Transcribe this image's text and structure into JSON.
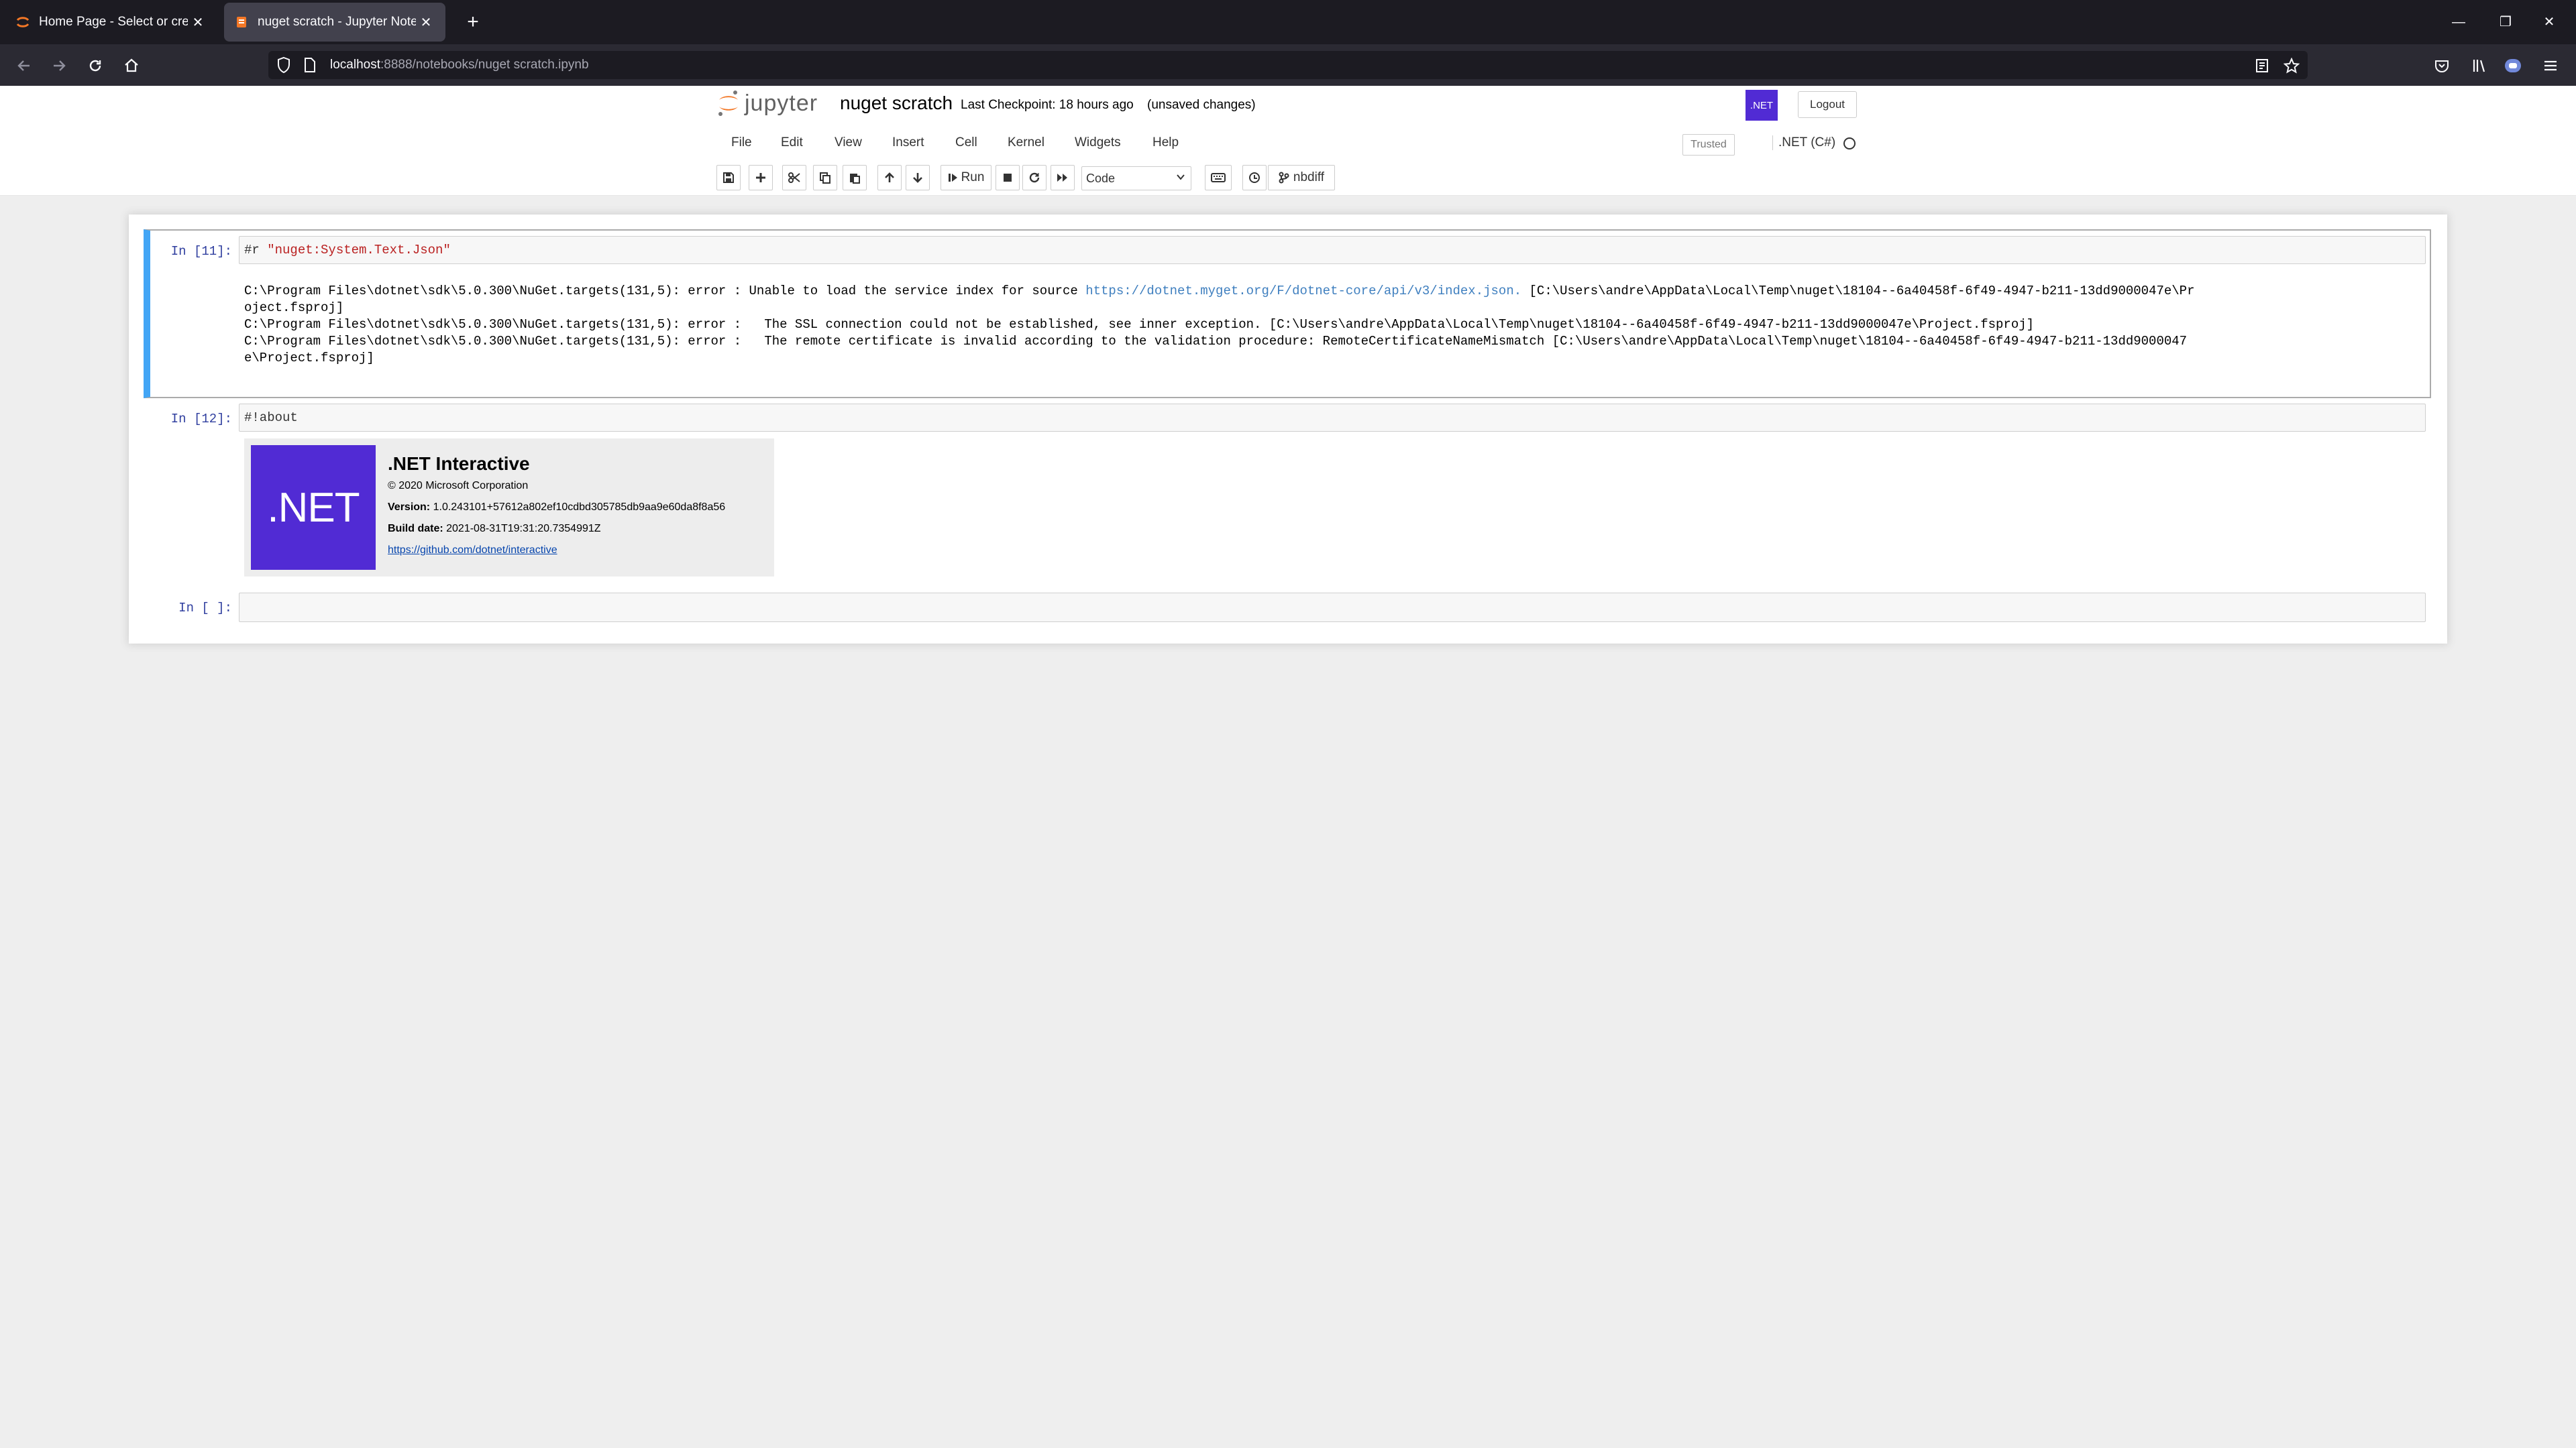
{
  "browser": {
    "tabs": [
      {
        "title": "Home Page - Select or create a",
        "close": "✕"
      },
      {
        "title": "nuget scratch - Jupyter Noteb",
        "close": "✕"
      }
    ],
    "new_tab": "+",
    "url_host": "localhost",
    "url_rest": ":8888/notebooks/nuget scratch.ipynb",
    "window_controls": {
      "minimize": "—",
      "restore": "❐",
      "close": "✕"
    }
  },
  "header": {
    "logo_text": "jupyter",
    "notebook_name": "nuget scratch",
    "checkpoint": "Last Checkpoint: 18 hours ago",
    "unsaved": "(unsaved changes)",
    "kernel_logo": ".NET",
    "logout": "Logout"
  },
  "menu": {
    "items": [
      "File",
      "Edit",
      "View",
      "Insert",
      "Cell",
      "Kernel",
      "Widgets",
      "Help"
    ],
    "trusted": "Trusted",
    "kernel_name": ".NET (C#)"
  },
  "toolbar": {
    "run": "Run",
    "cell_type": "Code",
    "nbdiff": "nbdiff"
  },
  "cells": [
    {
      "prompt": "In [11]:",
      "source_prefix": "#r ",
      "source_string": "\"nuget:System.Text.Json\"",
      "output": [
        {
          "text": "C:\\Program Files\\dotnet\\sdk\\5.0.300\\NuGet.targets(131,5): error : Unable to load the service index for source ",
          "link": "https://dotnet.myget.org/F/dotnet-core/api/v3/index.json.",
          "tail": " [C:\\Users\\andre\\AppData\\Local\\Temp\\nuget\\18104--6a40458f-6f49-4947-b211-13dd9000047e\\Pr"
        },
        {
          "text": "oject.fsproj]"
        },
        {
          "text": "C:\\Program Files\\dotnet\\sdk\\5.0.300\\NuGet.targets(131,5): error :   The SSL connection could not be established, see inner exception. [C:\\Users\\andre\\AppData\\Local\\Temp\\nuget\\18104--6a40458f-6f49-4947-b211-13dd9000047e\\Project.fsproj]"
        },
        {
          "text": "C:\\Program Files\\dotnet\\sdk\\5.0.300\\NuGet.targets(131,5): error :   The remote certificate is invalid according to the validation procedure: RemoteCertificateNameMismatch [C:\\Users\\andre\\AppData\\Local\\Temp\\nuget\\18104--6a40458f-6f49-4947-b211-13dd9000047"
        },
        {
          "text": "e\\Project.fsproj]"
        }
      ]
    },
    {
      "prompt": "In [12]:",
      "source": "#!about",
      "about": {
        "logo": ".NET",
        "title": ".NET Interactive",
        "copyright": "© 2020 Microsoft Corporation",
        "version_label": "Version:",
        "version": "1.0.243101+57612a802ef10cdbd305785db9aa9e60da8f8a56",
        "build_label": "Build date:",
        "build_date": "2021-08-31T19:31:20.7354991Z",
        "link": "https://github.com/dotnet/interactive"
      }
    },
    {
      "prompt": "In [ ]:",
      "source": ""
    }
  ],
  "colors": {
    "dotnet_purple": "#512bd4",
    "selected_cell_bar": "#42a5f5",
    "prompt_blue": "#303f9f",
    "string_red": "#ba2121",
    "link_blue": "#3f7fbf"
  }
}
